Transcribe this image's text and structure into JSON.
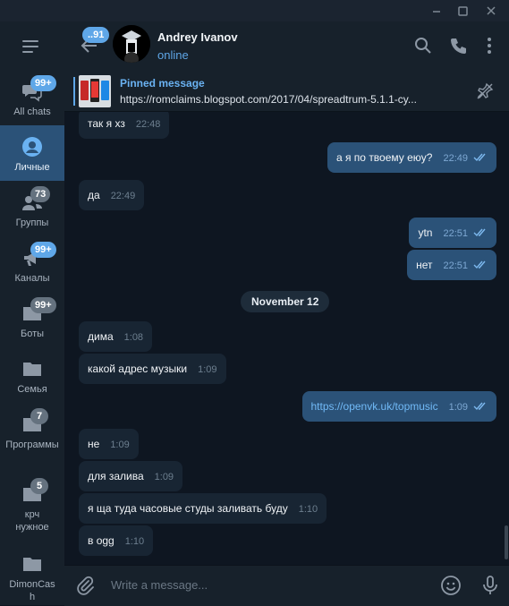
{
  "sidebar": {
    "folders": [
      {
        "label": "All chats",
        "badge": "99+",
        "icon": "chat-bubbles-icon"
      },
      {
        "label": "Личные",
        "badge": "",
        "icon": "person-icon",
        "active": true
      },
      {
        "label": "Группы",
        "badge": "73",
        "icon": "people-icon"
      },
      {
        "label": "Каналы",
        "badge": "99+",
        "icon": "megaphone-icon"
      },
      {
        "label": "Боты",
        "badge": "99+",
        "icon": "folder-icon"
      },
      {
        "label": "Семья",
        "badge": "",
        "icon": "folder-icon"
      },
      {
        "label": "Программы",
        "badge": "7",
        "icon": "folder-icon"
      },
      {
        "label": "крч нужное",
        "badge": "5",
        "icon": "folder-icon"
      },
      {
        "label": "DimonCash",
        "badge": "",
        "icon": "folder-icon"
      }
    ]
  },
  "header": {
    "back_badge": "..91",
    "name": "Andrey Ivanov",
    "status": "online"
  },
  "pinned": {
    "title": "Pinned message",
    "text": "https://romclaims.blogspot.com/2017/04/spreadtrum-5.1.1-cy..."
  },
  "messages": [
    {
      "dir": "in",
      "text": "так я хз",
      "time": "22:48"
    },
    {
      "dir": "out",
      "text": "а я по твоему еюу?",
      "time": "22:49"
    },
    {
      "dir": "in",
      "text": "да",
      "time": "22:49"
    },
    {
      "dir": "out",
      "text": "ytn",
      "time": "22:51"
    },
    {
      "dir": "out",
      "text": "нет",
      "time": "22:51"
    },
    {
      "dir": "in",
      "text": "дима",
      "time": "1:08"
    },
    {
      "dir": "in",
      "text": "какой адрес музыки",
      "time": "1:09"
    },
    {
      "dir": "out",
      "text": "https://openvk.uk/topmusic",
      "time": "1:09",
      "link": true
    },
    {
      "dir": "in",
      "text": "не",
      "time": "1:09"
    },
    {
      "dir": "in",
      "text": "для залива",
      "time": "1:09"
    },
    {
      "dir": "in",
      "text": "я ща туда часовые студы заливать буду",
      "time": "1:10"
    },
    {
      "dir": "in",
      "text": "в ogg",
      "time": "1:10"
    }
  ],
  "date_separator": "November 12",
  "composer": {
    "placeholder": "Write a message..."
  },
  "colors": {
    "accent": "#5fa7e8",
    "outgoing_bubble": "#2b5278",
    "incoming_bubble": "#182533",
    "background": "#0e1621"
  }
}
